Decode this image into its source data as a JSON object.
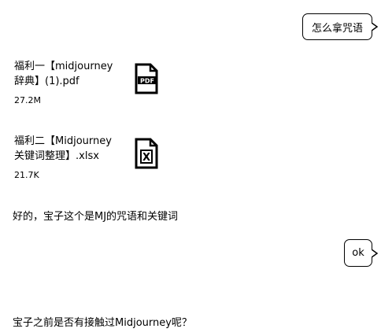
{
  "messages": [
    {
      "side": "right",
      "text": "怎么拿咒语"
    },
    {
      "side": "left",
      "file": {
        "name": "福利一【midjourney\n辞典】(1).pdf",
        "size": "27.2M",
        "icon": "pdf-file-icon",
        "badge": "PDF"
      }
    },
    {
      "side": "left",
      "file": {
        "name": "福利二【Midjourney\n关键词整理】.xlsx",
        "size": "21.7K",
        "icon": "excel-file-icon",
        "badge": "X"
      }
    },
    {
      "side": "left",
      "text": "好的，宝子这个是MJ的咒语和关键词"
    },
    {
      "side": "right",
      "text": "ok"
    },
    {
      "side": "left",
      "text": "宝子之前是否有接触过Midjourney呢？"
    }
  ],
  "colors": {
    "background": "#ffffff",
    "ink": "#000000"
  }
}
